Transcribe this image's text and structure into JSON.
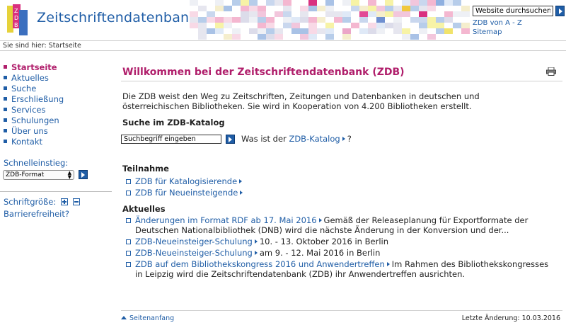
{
  "header": {
    "title": "Zeitschriftendatenbank",
    "search_value": "Website durchsuchen",
    "links": [
      "ZDB von A - Z",
      "Sitemap"
    ]
  },
  "breadcrumb": "Sie sind hier: Startseite",
  "sidebar": {
    "items": [
      {
        "label": "Startseite",
        "active": true
      },
      {
        "label": "Aktuelles"
      },
      {
        "label": "Suche"
      },
      {
        "label": "Erschließung"
      },
      {
        "label": "Services"
      },
      {
        "label": "Schulungen"
      },
      {
        "label": "Über uns"
      },
      {
        "label": "Kontakt"
      }
    ],
    "quick_label": "Schnelleinstieg:",
    "quick_select": "ZDB-Format",
    "font_size_label": "Schriftgröße:",
    "accessibility": "Barrierefreiheit?"
  },
  "main": {
    "title": "Willkommen bei der Zeitschriftendatenbank (ZDB)",
    "intro": "Die ZDB weist den Weg zu Zeitschriften, Zeitungen und Datenbanken in deutschen und österreichischen Bibliotheken. Sie wird in Kooperation von 4.200 Bibliotheken erstellt.",
    "catalog": {
      "heading": "Suche im ZDB-Katalog",
      "input_value": "Suchbegriff eingeben",
      "question_pre": "Was ist der",
      "question_link": "ZDB-Katalog",
      "question_post": "?"
    },
    "participation": {
      "heading": "Teilnahme",
      "items": [
        "ZDB für Katalogisierende",
        "ZDB für Neueinsteigende"
      ]
    },
    "news": {
      "heading": "Aktuelles",
      "items": [
        {
          "link": "Änderungen im Format RDF ab 17. Mai 2016",
          "text": "Gemäß der Releaseplanung für Exportformate der Deutschen Nationalbibliothek (DNB) wird die nächste Änderung in der Konversion und der..."
        },
        {
          "link": "ZDB-Neueinsteiger-Schulung",
          "text": "10. - 13. Oktober 2016 in Berlin"
        },
        {
          "link": "ZDB-Neueinsteiger-Schulung",
          "text": "am 9. - 12. Mai 2016 in Berlin"
        },
        {
          "link": "ZDB auf dem Bibliothekskongress 2016 und Anwendertreffen",
          "text": "Im Rahmen des Bibliothekskongresses in Leipzig wird die Zeitschriftendatenbank (ZDB) ihr Anwendertreffen ausrichten."
        }
      ]
    }
  },
  "footer": {
    "top_link": "Seitenanfang",
    "last_change": "Letzte Änderung: 10.03.2016"
  },
  "colors": {
    "brand_blue": "#1f5da6",
    "accent_magenta": "#b01e6b"
  }
}
